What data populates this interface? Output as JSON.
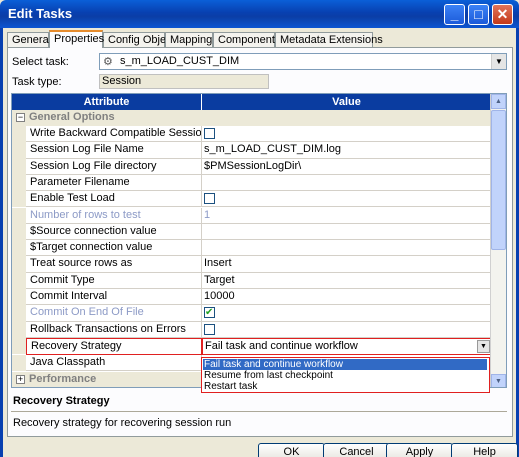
{
  "window": {
    "title": "Edit Tasks",
    "minimize": "_",
    "maximize": "□",
    "close": "✕"
  },
  "tabs": [
    "General",
    "Properties",
    "Config Object",
    "Mapping",
    "Components",
    "Metadata Extensions"
  ],
  "select_task": {
    "label": "Select task:",
    "value": "s_m_LOAD_CUST_DIM"
  },
  "task_type": {
    "label": "Task type:",
    "value": "Session"
  },
  "grid": {
    "headers": {
      "attribute": "Attribute",
      "value": "Value"
    },
    "groups": {
      "general": "General Options",
      "performance": "Performance"
    },
    "rows": [
      {
        "attr": "Write Backward Compatible Session Log File",
        "value": "",
        "checkbox": false
      },
      {
        "attr": "Session Log File Name",
        "value": "s_m_LOAD_CUST_DIM.log"
      },
      {
        "attr": "Session Log File directory",
        "value": "$PMSessionLogDir\\"
      },
      {
        "attr": "Parameter Filename",
        "value": ""
      },
      {
        "attr": "Enable Test Load",
        "value": "",
        "checkbox": false
      },
      {
        "attr": "Number of rows to test",
        "value": "1",
        "dim": true
      },
      {
        "attr": "$Source connection value",
        "value": ""
      },
      {
        "attr": "$Target connection value",
        "value": ""
      },
      {
        "attr": "Treat source rows as",
        "value": "Insert"
      },
      {
        "attr": "Commit Type",
        "value": "Target"
      },
      {
        "attr": "Commit Interval",
        "value": "10000"
      },
      {
        "attr": "Commit On End Of File",
        "value": "",
        "checkbox": true,
        "dim": true
      },
      {
        "attr": "Rollback Transactions on Errors",
        "value": "",
        "checkbox": false
      }
    ],
    "recovery": {
      "attr": "Recovery Strategy",
      "value": "Fail task and continue workflow"
    },
    "java_classpath": {
      "attr": "Java Classpath"
    },
    "recovery_options": [
      "Fail task and continue workflow",
      "Resume from last checkpoint",
      "Restart task"
    ]
  },
  "description": {
    "title": "Recovery Strategy",
    "text": "Recovery strategy for recovering session run"
  },
  "buttons": {
    "ok": "OK",
    "cancel": "Cancel",
    "apply": "Apply",
    "help": "Help"
  }
}
